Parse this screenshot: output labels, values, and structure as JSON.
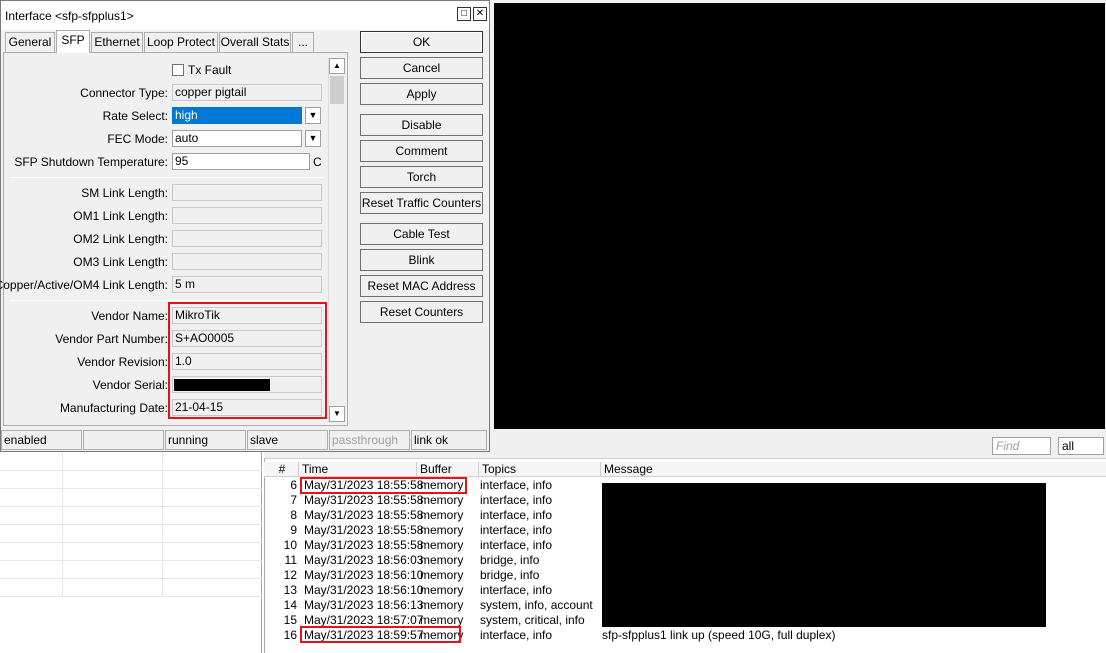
{
  "window": {
    "title": "Interface <sfp-sfpplus1>"
  },
  "tabs": [
    "General",
    "SFP",
    "Ethernet",
    "Loop Protect",
    "Overall Stats",
    "..."
  ],
  "sfp": {
    "tx_fault_label": "Tx Fault",
    "connector_type": {
      "label": "Connector Type:",
      "value": "copper pigtail"
    },
    "rate_select": {
      "label": "Rate Select:",
      "value": "high"
    },
    "fec_mode": {
      "label": "FEC Mode:",
      "value": "auto"
    },
    "shutdown_temp": {
      "label": "SFP Shutdown Temperature:",
      "value": "95",
      "unit": "C"
    },
    "sm_link": {
      "label": "SM Link Length:",
      "value": ""
    },
    "om1_link": {
      "label": "OM1 Link Length:",
      "value": ""
    },
    "om2_link": {
      "label": "OM2 Link Length:",
      "value": ""
    },
    "om3_link": {
      "label": "OM3 Link Length:",
      "value": ""
    },
    "copper_link": {
      "label": "Copper/Active/OM4 Link Length:",
      "value": "5 m"
    },
    "vendor_name": {
      "label": "Vendor Name:",
      "value": "MikroTik"
    },
    "vendor_part": {
      "label": "Vendor Part Number:",
      "value": "S+AO0005"
    },
    "vendor_rev": {
      "label": "Vendor Revision:",
      "value": "1.0"
    },
    "vendor_serial": {
      "label": "Vendor Serial:",
      "value": ""
    },
    "mfg_date": {
      "label": "Manufacturing Date:",
      "value": "21-04-15"
    }
  },
  "buttons": {
    "ok": "OK",
    "cancel": "Cancel",
    "apply": "Apply",
    "disable": "Disable",
    "comment": "Comment",
    "torch": "Torch",
    "reset_traffic": "Reset Traffic Counters",
    "cable_test": "Cable Test",
    "blink": "Blink",
    "reset_mac": "Reset MAC Address",
    "reset_counters": "Reset Counters"
  },
  "status_bar": [
    "enabled",
    "",
    "running",
    "slave",
    "passthrough",
    "link ok"
  ],
  "log": {
    "find_placeholder": "Find",
    "filter": "all",
    "columns": [
      "#",
      "Time",
      "Buffer",
      "Topics",
      "Message"
    ],
    "rows": [
      {
        "n": "6",
        "time": "May/31/2023 18:55:58",
        "buffer": "memory",
        "topics": "interface, info",
        "msg": ""
      },
      {
        "n": "7",
        "time": "May/31/2023 18:55:58",
        "buffer": "memory",
        "topics": "interface, info",
        "msg": ""
      },
      {
        "n": "8",
        "time": "May/31/2023 18:55:58",
        "buffer": "memory",
        "topics": "interface, info",
        "msg": ""
      },
      {
        "n": "9",
        "time": "May/31/2023 18:55:58",
        "buffer": "memory",
        "topics": "interface, info",
        "msg": ""
      },
      {
        "n": "10",
        "time": "May/31/2023 18:55:58",
        "buffer": "memory",
        "topics": "interface, info",
        "msg": ""
      },
      {
        "n": "11",
        "time": "May/31/2023 18:56:03",
        "buffer": "memory",
        "topics": "bridge, info",
        "msg": ""
      },
      {
        "n": "12",
        "time": "May/31/2023 18:56:10",
        "buffer": "memory",
        "topics": "bridge, info",
        "msg": ""
      },
      {
        "n": "13",
        "time": "May/31/2023 18:56:10",
        "buffer": "memory",
        "topics": "interface, info",
        "msg": ""
      },
      {
        "n": "14",
        "time": "May/31/2023 18:56:13",
        "buffer": "memory",
        "topics": "system, info, account",
        "msg": ""
      },
      {
        "n": "15",
        "time": "May/31/2023 18:57:07",
        "buffer": "memory",
        "topics": "system, critical, info",
        "msg": ""
      },
      {
        "n": "16",
        "time": "May/31/2023 18:59:57",
        "buffer": "memory",
        "topics": "interface, info",
        "msg": "sfp-sfpplus1 link up (speed 10G, full duplex)"
      }
    ]
  },
  "colors": {
    "highlight": "#e0141a",
    "selection": "#0078d7",
    "redaction": "#000000"
  }
}
